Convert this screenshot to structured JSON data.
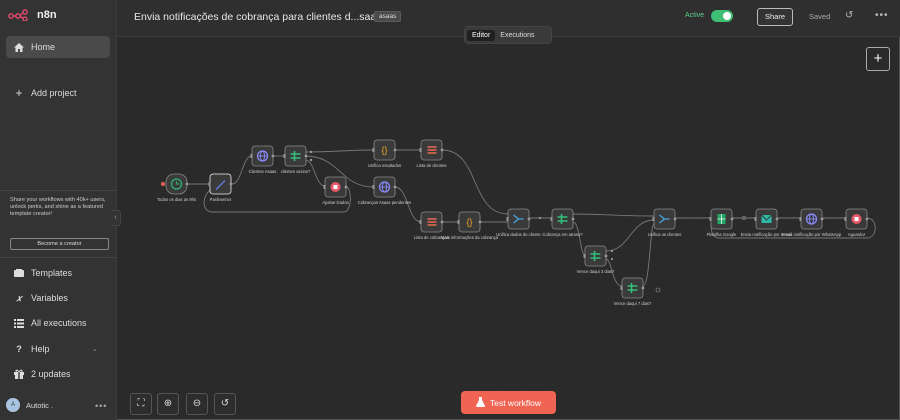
{
  "app": {
    "name": "n8n"
  },
  "sidebar": {
    "items": [
      {
        "label": "Home",
        "icon": "home-icon"
      },
      {
        "label": "Add project",
        "icon": "plus-icon"
      }
    ],
    "promo": {
      "text": "Share your workflows with 40k+ users, unlock perks, and shine as a featured template creator!",
      "button": "Become a creator"
    },
    "bottom": [
      {
        "label": "Templates",
        "icon": "templates-icon"
      },
      {
        "label": "Variables",
        "icon": "variables-icon"
      },
      {
        "label": "All executions",
        "icon": "executions-icon"
      },
      {
        "label": "Help",
        "icon": "help-icon"
      },
      {
        "label": "2 updates",
        "icon": "gift-icon"
      }
    ],
    "user": {
      "initials": "A",
      "name": "Autotic ."
    }
  },
  "header": {
    "title": "Envia notificações de cobrança para clientes d...saas",
    "tag": "asaas",
    "active_label": "Active",
    "active": true,
    "share": "Share",
    "saved": "Saved",
    "tabs": [
      "Editor",
      "Executions"
    ]
  },
  "canvas": {
    "test_button": "Test workflow"
  },
  "colors": {
    "accent": "#ef6452",
    "active": "#3fbf74",
    "schedule": "#2fa36b",
    "code": "#f5a623",
    "http": "#8b8bff",
    "if": "#33c07a",
    "split": "#3b8ed8",
    "merge": "#4aa3df"
  },
  "nodes": [
    {
      "id": "schedule",
      "label": "Todos os dias as 9hs",
      "icon": "clock-icon"
    },
    {
      "id": "params",
      "label": "Parâmetros",
      "icon": "pencil-icon"
    },
    {
      "id": "clientes",
      "label": "Clientes Asaas",
      "icon": "globe-icon"
    },
    {
      "id": "if1",
      "label": "clientes vazios?",
      "icon": "if-icon"
    },
    {
      "id": "ajustar",
      "label": "Ajustar Dados",
      "icon": "stop-icon"
    },
    {
      "id": "unifica",
      "label": "Unifica resultados",
      "icon": "code-icon"
    },
    {
      "id": "lista_cli",
      "label": "Lista de clientes",
      "icon": "list-icon"
    },
    {
      "id": "cobrancas",
      "label": "Cobranças Asaas pendentes",
      "icon": "globe-icon"
    },
    {
      "id": "lista_cob",
      "label": "Lista de cobranças",
      "icon": "list-icon"
    },
    {
      "id": "code2",
      "label": "Mais informações da cobrança",
      "icon": "code-icon"
    },
    {
      "id": "merge1",
      "label": "Unifica dados do cliente",
      "icon": "merge-icon"
    },
    {
      "id": "if2",
      "label": "Cobrança em atraso?",
      "icon": "if-icon"
    },
    {
      "id": "if3",
      "label": "Vence daqui 3 dias?",
      "icon": "if-icon"
    },
    {
      "id": "if4",
      "label": "Vence daqui 7 dias?",
      "icon": "if-icon"
    },
    {
      "id": "merge2",
      "label": "Unifica os clientes",
      "icon": "merge-icon"
    },
    {
      "id": "sheet",
      "label": "Planilha Google",
      "icon": "sheet-icon"
    },
    {
      "id": "email",
      "label": "Envia notificação por e-mail",
      "icon": "mail-icon"
    },
    {
      "id": "wpp",
      "label": "Envia notificação por WhatsApp",
      "icon": "globe-icon"
    },
    {
      "id": "stop",
      "label": "Aguardar",
      "icon": "stop-icon"
    }
  ]
}
